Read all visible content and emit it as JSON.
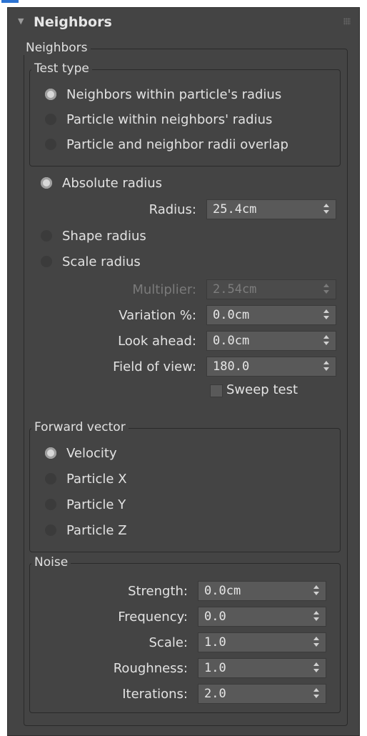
{
  "rollout": {
    "title": "Neighbors"
  },
  "neighbors_group": {
    "title": "Neighbors"
  },
  "test_type": {
    "title": "Test type",
    "options": [
      {
        "label": "Neighbors within particle's radius",
        "selected": true
      },
      {
        "label": "Particle within neighbors' radius",
        "selected": false
      },
      {
        "label": "Particle and neighbor radii overlap",
        "selected": false
      }
    ]
  },
  "radius_mode": {
    "absolute": {
      "label": "Absolute radius",
      "selected": true
    },
    "shape": {
      "label": "Shape radius",
      "selected": false
    },
    "scale": {
      "label": "Scale radius",
      "selected": false
    }
  },
  "fields": {
    "radius": {
      "label": "Radius:",
      "value": "25.4cm"
    },
    "multiplier": {
      "label": "Multiplier:",
      "value": "2.54cm",
      "disabled": true
    },
    "variation": {
      "label": "Variation %:",
      "value": "0.0cm"
    },
    "look_ahead": {
      "label": "Look ahead:",
      "value": "0.0cm"
    },
    "field_of_view": {
      "label": "Field of view:",
      "value": "180.0"
    }
  },
  "sweep_test": {
    "label": "Sweep test",
    "checked": false
  },
  "forward_vector": {
    "title": "Forward vector",
    "options": [
      {
        "label": "Velocity",
        "selected": true
      },
      {
        "label": "Particle X",
        "selected": false
      },
      {
        "label": "Particle Y",
        "selected": false
      },
      {
        "label": "Particle Z",
        "selected": false
      }
    ]
  },
  "noise": {
    "title": "Noise",
    "fields": [
      {
        "label": "Strength:",
        "value": "0.0cm"
      },
      {
        "label": "Frequency:",
        "value": "0.0"
      },
      {
        "label": "Scale:",
        "value": "1.0"
      },
      {
        "label": "Roughness:",
        "value": "1.0"
      },
      {
        "label": "Iterations:",
        "value": "2.0"
      }
    ]
  },
  "colors": {
    "panel": "#444444",
    "accent": "#2c73d2",
    "field": "#595959"
  }
}
